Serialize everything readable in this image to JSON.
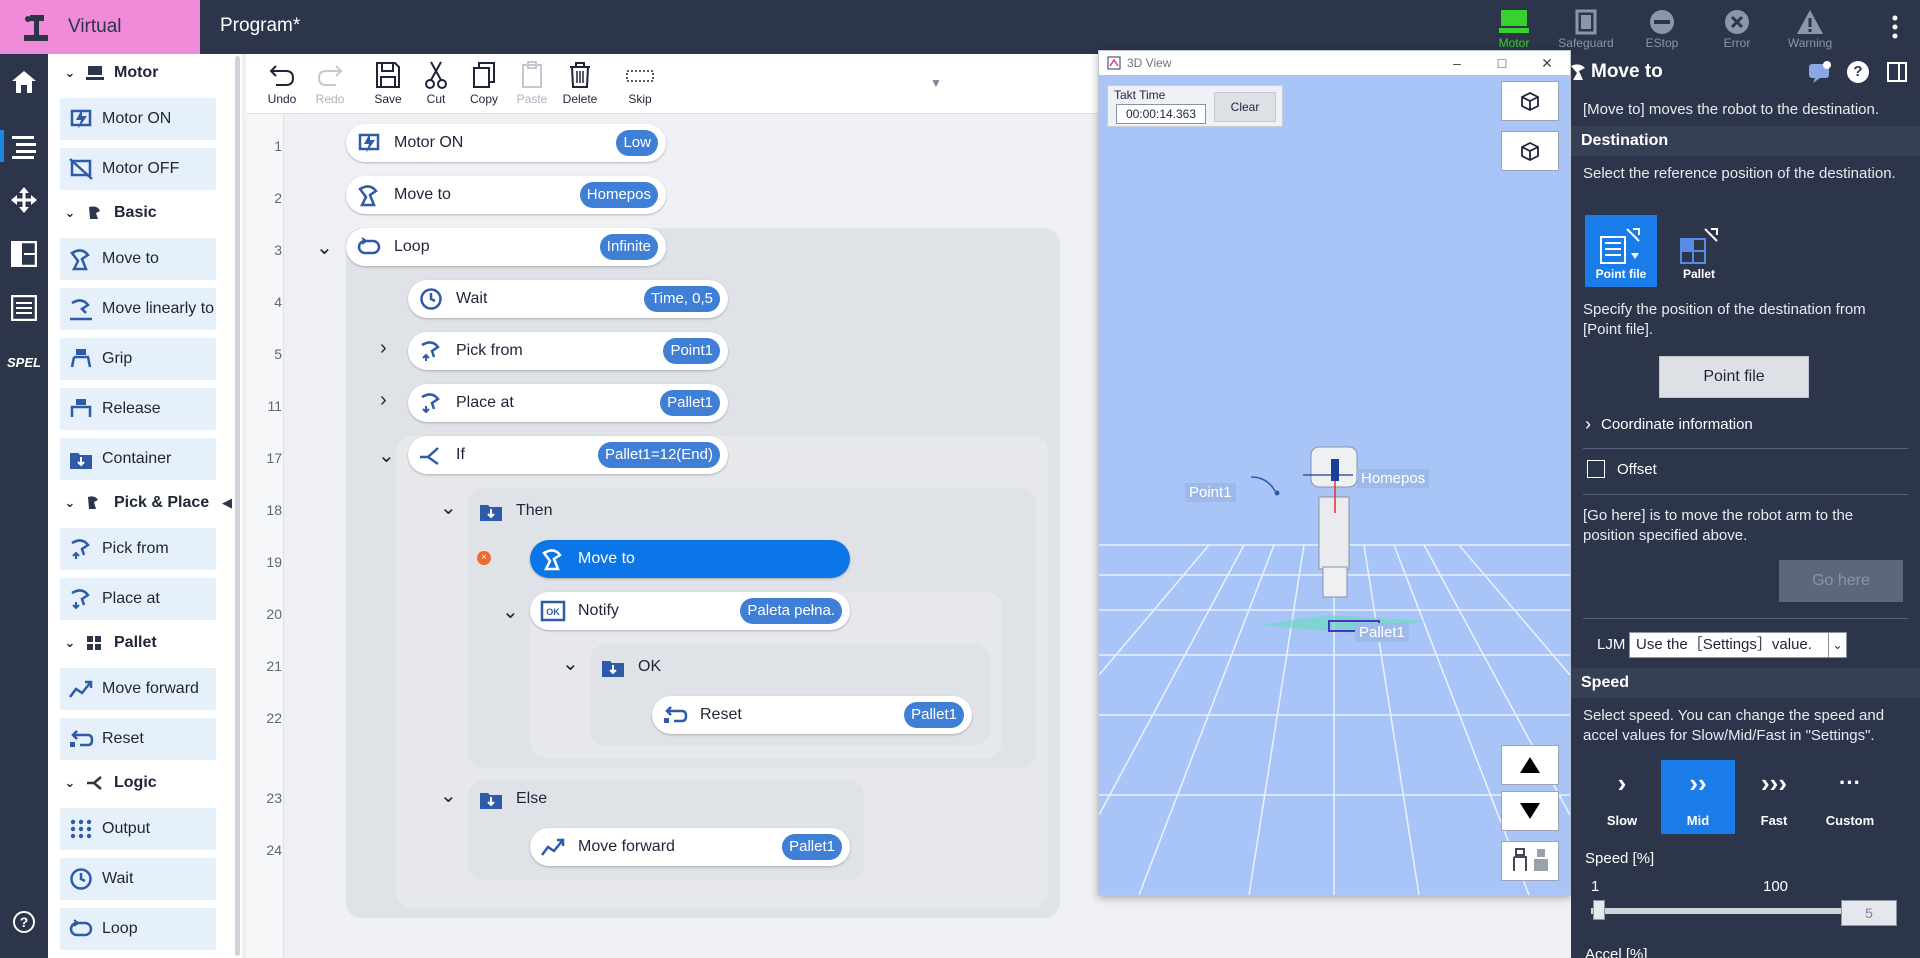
{
  "header": {
    "mode_label": "Virtual",
    "program_title": "Program*",
    "status": [
      {
        "label": "Motor",
        "active": true
      },
      {
        "label": "Safeguard",
        "active": false
      },
      {
        "label": "EStop",
        "active": false
      },
      {
        "label": "Error",
        "active": false
      },
      {
        "label": "Warning",
        "active": false
      }
    ]
  },
  "left_nav": [
    "home-icon",
    "program-icon",
    "jog-icon",
    "layout-icon",
    "list-icon",
    "spel-icon",
    "help-icon"
  ],
  "left_nav_spel": "SPEL",
  "left_nav_help": "?",
  "palette": {
    "categories": {
      "motor": "Motor",
      "basic": "Basic",
      "pickplace": "Pick & Place",
      "pallet": "Pallet",
      "logic": "Logic"
    },
    "items": {
      "motor_on": "Motor ON",
      "motor_off": "Motor OFF",
      "move_to": "Move to",
      "move_linearly": "Move linearly to",
      "grip": "Grip",
      "release": "Release",
      "container": "Container",
      "pick_from": "Pick from",
      "place_at": "Place at",
      "move_forward": "Move forward",
      "reset": "Reset",
      "output": "Output",
      "wait": "Wait",
      "loop": "Loop"
    }
  },
  "toolbar": {
    "undo": "Undo",
    "redo": "Redo",
    "save": "Save",
    "cut": "Cut",
    "copy": "Copy",
    "paste": "Paste",
    "delete": "Delete",
    "skip": "Skip"
  },
  "program": {
    "line_numbers": [
      "1",
      "2",
      "3",
      "4",
      "5",
      "11",
      "17",
      "18",
      "19",
      "20",
      "21",
      "22",
      "23",
      "24"
    ],
    "commands": {
      "l1": {
        "label": "Motor ON",
        "param": "Low"
      },
      "l2": {
        "label": "Move to",
        "param": "Homepos"
      },
      "l3": {
        "label": "Loop",
        "param": "Infinite"
      },
      "l4": {
        "label": "Wait",
        "param": "Time, 0,5"
      },
      "l5": {
        "label": "Pick from",
        "param": "Point1"
      },
      "l11": {
        "label": "Place at",
        "param": "Pallet1"
      },
      "l17": {
        "label": "If",
        "param": "Pallet1=12(End)"
      },
      "l18": {
        "label": "Then"
      },
      "l19": {
        "label": "Move to"
      },
      "l20": {
        "label": "Notify",
        "param": "Paleta pełna."
      },
      "l21": {
        "label": "OK"
      },
      "l22": {
        "label": "Reset",
        "param": "Pallet1"
      },
      "l23": {
        "label": "Else"
      },
      "l24": {
        "label": "Move forward",
        "param": "Pallet1"
      }
    },
    "error_glyph": "×"
  },
  "view3d": {
    "title": "3D View",
    "takt_label": "Takt Time",
    "takt_value": "00:00:14.363",
    "clear": "Clear",
    "labels": {
      "point1": "Point1",
      "homepos": "Homepos",
      "pallet1": "Pallet1"
    }
  },
  "properties": {
    "title": "Move to",
    "description": "[Move to] moves the robot to the destination.",
    "destination_header": "Destination",
    "destination_text": "Select the reference position of the destination.",
    "tiles": {
      "point_file": "Point file",
      "pallet": "Pallet"
    },
    "specify_text": "Specify the position of the destination from [Point file].",
    "point_file_button": "Point file",
    "coord_info": "Coordinate information",
    "offset": "Offset",
    "go_here_text": "[Go here] is to move the robot arm to the position specified above.",
    "go_here_button": "Go here",
    "ljm_label": "LJM",
    "ljm_value": "Use the［Settings］value.",
    "speed_header": "Speed",
    "speed_text": "Select speed. You can change the speed and accel values for Slow/Mid/Fast in \"Settings\".",
    "speeds": {
      "slow": "Slow",
      "mid": "Mid",
      "fast": "Fast",
      "custom": "Custom"
    },
    "speed_selected": "Mid",
    "speed_percent_label": "Speed [%]",
    "speed_min": "1",
    "speed_max": "100",
    "speed_value": "5",
    "accel_label": "Accel [%]"
  },
  "colors": {
    "accent": "#1a7ce8",
    "header": "#2c3549",
    "mode": "#f08bd9",
    "motor_on": "#39d12e"
  }
}
